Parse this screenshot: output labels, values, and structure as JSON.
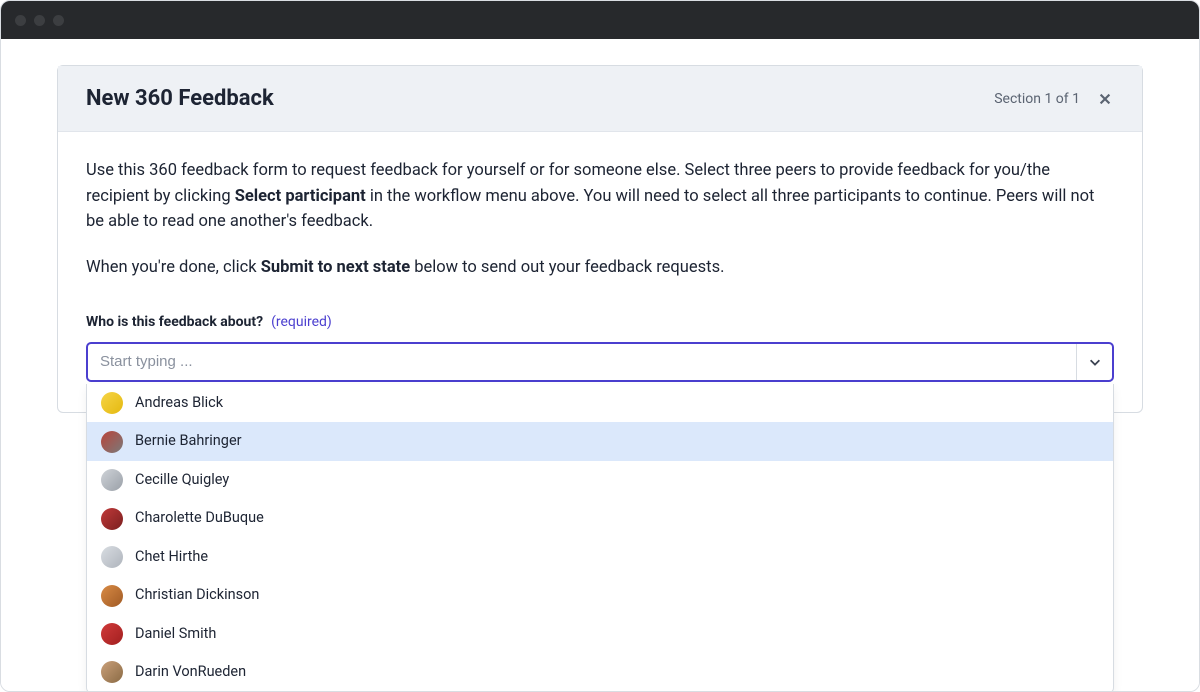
{
  "header": {
    "title": "New 360 Feedback",
    "section_label": "Section 1 of 1"
  },
  "intro": {
    "p1_a": "Use this 360 feedback form to request feedback for yourself or for someone else. Select three peers to provide feedback for you/the recipient by clicking ",
    "p1_bold": "Select participant",
    "p1_b": " in the workflow menu above. You will need to select all three participants to continue. Peers will not be able to read one another's feedback.",
    "p2_a": "When you're done, click ",
    "p2_bold": "Submit to next state",
    "p2_b": " below to send out your feedback requests."
  },
  "field": {
    "label": "Who is this feedback about?",
    "required": "(required)",
    "placeholder": "Start typing ..."
  },
  "options": [
    {
      "name": "Andreas Blick",
      "avatar_bg": "linear-gradient(135deg,#f6d447,#e4b90f)",
      "highlight": false
    },
    {
      "name": "Bernie Bahringer",
      "avatar_bg": "linear-gradient(135deg,#b9443a,#7a7a7a)",
      "highlight": true
    },
    {
      "name": "Cecille Quigley",
      "avatar_bg": "linear-gradient(135deg,#cfd3d8,#9aa0a8)",
      "highlight": false
    },
    {
      "name": "Charolette DuBuque",
      "avatar_bg": "linear-gradient(135deg,#c13a3a,#7a1f1f)",
      "highlight": false
    },
    {
      "name": "Chet Hirthe",
      "avatar_bg": "linear-gradient(135deg,#d9dde2,#aeb4bc)",
      "highlight": false
    },
    {
      "name": "Christian Dickinson",
      "avatar_bg": "linear-gradient(135deg,#d98b45,#a05a24)",
      "highlight": false
    },
    {
      "name": "Daniel Smith",
      "avatar_bg": "linear-gradient(135deg,#d13a3a,#a11f1f)",
      "highlight": false
    },
    {
      "name": "Darin VonRueden",
      "avatar_bg": "linear-gradient(135deg,#caa07a,#8a6a44)",
      "highlight": false
    }
  ]
}
